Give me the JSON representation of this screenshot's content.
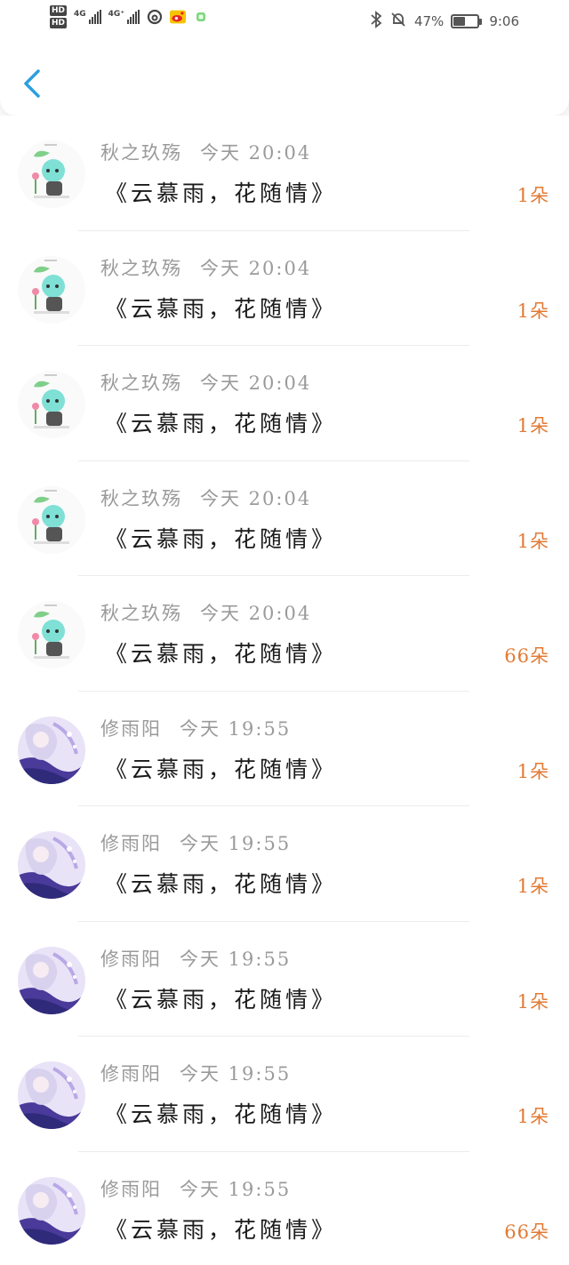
{
  "status_bar": {
    "hd1": "HD",
    "hd2": "HD",
    "net1": "4G",
    "net2": "4G⁺",
    "battery_text": "47%",
    "battery_level": 0.47,
    "time": "9:06"
  },
  "header": {
    "back_icon": "chevron-left-icon",
    "accent": "#2a9fe0"
  },
  "rows": [
    {
      "name": "秋之玖殇",
      "time": "今天 20:04",
      "title": "《云慕雨，花随情》",
      "count": "1朵",
      "avatar": "green"
    },
    {
      "name": "秋之玖殇",
      "time": "今天 20:04",
      "title": "《云慕雨，花随情》",
      "count": "1朵",
      "avatar": "green"
    },
    {
      "name": "秋之玖殇",
      "time": "今天 20:04",
      "title": "《云慕雨，花随情》",
      "count": "1朵",
      "avatar": "green"
    },
    {
      "name": "秋之玖殇",
      "time": "今天 20:04",
      "title": "《云慕雨，花随情》",
      "count": "1朵",
      "avatar": "green"
    },
    {
      "name": "秋之玖殇",
      "time": "今天 20:04",
      "title": "《云慕雨，花随情》",
      "count": "66朵",
      "avatar": "green"
    },
    {
      "name": "修雨阳",
      "time": "今天 19:55",
      "title": "《云慕雨，花随情》",
      "count": "1朵",
      "avatar": "purple"
    },
    {
      "name": "修雨阳",
      "time": "今天 19:55",
      "title": "《云慕雨，花随情》",
      "count": "1朵",
      "avatar": "purple"
    },
    {
      "name": "修雨阳",
      "time": "今天 19:55",
      "title": "《云慕雨，花随情》",
      "count": "1朵",
      "avatar": "purple"
    },
    {
      "name": "修雨阳",
      "time": "今天 19:55",
      "title": "《云慕雨，花随情》",
      "count": "1朵",
      "avatar": "purple"
    },
    {
      "name": "修雨阳",
      "time": "今天 19:55",
      "title": "《云慕雨，花随情》",
      "count": "66朵",
      "avatar": "purple"
    }
  ]
}
